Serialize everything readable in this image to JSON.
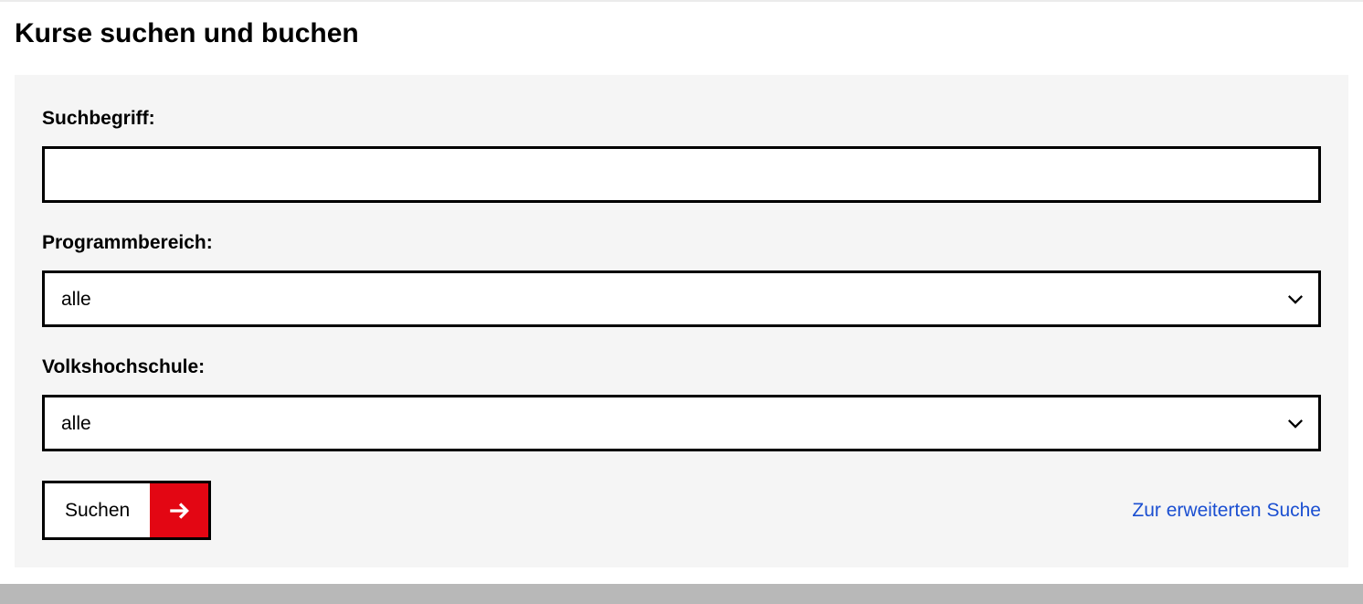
{
  "page": {
    "title": "Kurse suchen und buchen"
  },
  "form": {
    "search_term": {
      "label": "Suchbegriff:",
      "value": ""
    },
    "program_area": {
      "label": "Programmbereich:",
      "selected": "alle"
    },
    "vhs": {
      "label": "Volkshochschule:",
      "selected": "alle"
    },
    "submit_label": "Suchen",
    "advanced_link": "Zur erweiterten Suche"
  }
}
